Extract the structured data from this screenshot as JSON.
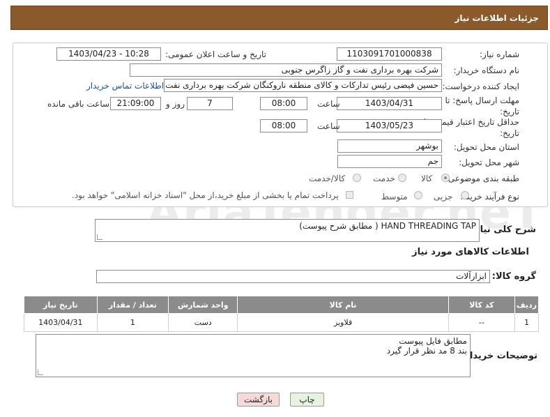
{
  "header": {
    "title": "جزئیات اطلاعات نیاز"
  },
  "form": {
    "need_number_label": "شماره نیاز:",
    "need_number": "1103091701000838",
    "announce_label": "تاریخ و ساعت اعلان عمومی:",
    "announce_value": "1403/04/23 - 10:28",
    "buyer_org_label": "نام دستگاه خریدار:",
    "buyer_org": "شرکت بهره برداری نفت و گاز زاگرس جنوبی",
    "requester_label": "ایجاد کننده درخواست:",
    "requester": "حسین فیضی رئیس تدارکات و کالای منطقه ناروکنگان شرکت بهره برداری نفت و",
    "contact_link": "اطلاعات تماس خریدار",
    "deadline_label": "مهلت ارسال پاسخ: تا تاریخ:",
    "deadline_date": "1403/04/31",
    "time_label": "ساعت",
    "deadline_time": "08:00",
    "days_value": "7",
    "days_label": "روز و",
    "remaining_time": "21:09:00",
    "remaining_label": "ساعت باقی مانده",
    "validity_label": "حداقل تاریخ اعتبار قیمت: تا تاریخ:",
    "validity_date": "1403/05/23",
    "validity_time": "08:00",
    "province_label": "استان محل تحویل:",
    "province": "بوشهر",
    "city_label": "شهر محل تحویل:",
    "city": "جم",
    "category_label": "طبقه بندی موضوعی:",
    "category_options": [
      "کالا",
      "خدمت",
      "کالا/خدمت"
    ],
    "process_label": "نوع فرآیند خرید :",
    "process_options": [
      "جزیی",
      "متوسط"
    ],
    "payment_text": "پرداخت تمام یا بخشی از مبلغ خرید،از محل \"اسناد خزانه اسلامی\" خواهد بود."
  },
  "description": {
    "label": "شرح کلی نیاز:",
    "value": "HAND THREADING TAP ( مطابق شرح پیوست)"
  },
  "items_section": {
    "title": "اطلاعات کالاهای مورد نیاز",
    "group_label": "گروه کالا:",
    "group_value": "ابزارآلات",
    "columns": [
      "ردیف",
      "کد کالا",
      "نام کالا",
      "واحد شمارش",
      "تعداد / مقدار",
      "تاریخ نیاز"
    ],
    "rows": [
      [
        "1",
        "--",
        "قلاویز",
        "دست",
        "1",
        "1403/04/31"
      ]
    ]
  },
  "buyer_notes": {
    "label": "توضیحات خریدار:",
    "line1": "مطابق فایل پیوست",
    "line2": "بند 8 مد نظر قرار گیرد"
  },
  "buttons": {
    "print": "چاپ",
    "back": "بازگشت"
  },
  "watermark": "AriaTender.neT",
  "colors": {
    "header": "#8b5a2b",
    "table_header": "#8b8b8b",
    "link": "#1a4dc2",
    "back_button": "#f6dada",
    "print_button": "#e6f4df"
  }
}
